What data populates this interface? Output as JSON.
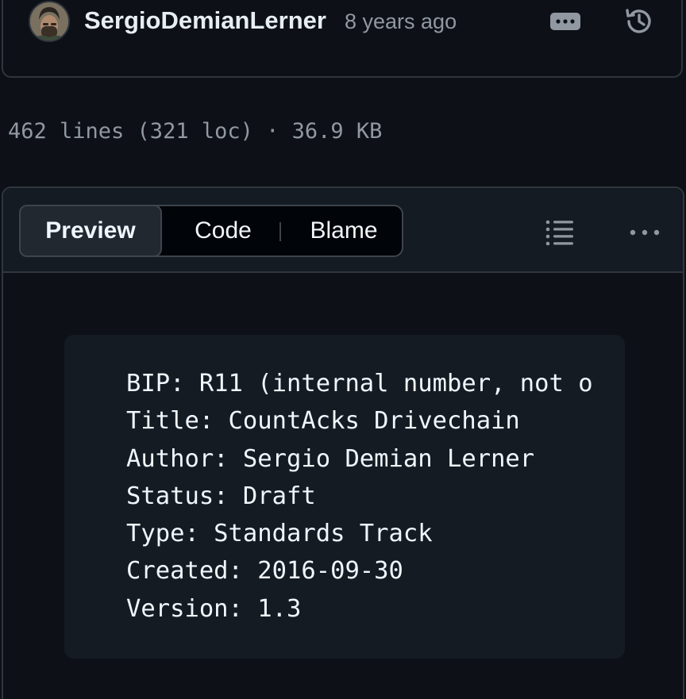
{
  "commit": {
    "author": "SergioDemianLerner",
    "time_ago": "8 years ago",
    "avatar_icon": "user-avatar",
    "actions": {
      "more_icon": "kebab-horizontal-icon",
      "history_icon": "history-icon"
    }
  },
  "file": {
    "meta": "462 lines (321 loc) · 36.9 KB"
  },
  "viewer": {
    "tabs": [
      {
        "label": "Preview",
        "selected": true
      },
      {
        "label": "Code",
        "selected": false
      },
      {
        "label": "Blame",
        "selected": false
      }
    ],
    "outline_icon": "list-unordered-icon",
    "more_icon": "kebab-horizontal-icon"
  },
  "content": {
    "lines": [
      "BIP: R11 (internal number, not o",
      "Title: CountAcks Drivechain",
      "Author: Sergio Demian Lerner",
      "Status: Draft",
      "Type: Standards Track",
      "Created: 2016-09-30",
      "Version: 1.3"
    ]
  },
  "colors": {
    "background": "#0d1117",
    "border": "#30363d",
    "muted_text": "#9198a1",
    "text": "#e6edf3"
  }
}
